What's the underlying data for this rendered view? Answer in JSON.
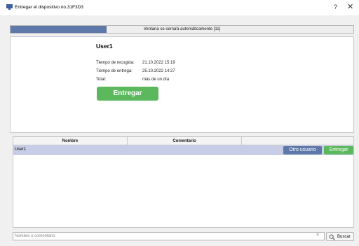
{
  "window": {
    "title": "Entregar el dispositivo no.31F3D3",
    "help": "?",
    "close": "✕"
  },
  "progress": {
    "text": "Ventana se cerrará automáticamente [11]",
    "fraction": 0.28,
    "color": "#5d78a9"
  },
  "info": {
    "user": "User1",
    "pickup_label": "Tiempo de recogida:",
    "pickup_value": "21.10.2022 15:19",
    "delivery_label": "Tiempo de entrega:",
    "delivery_value": "25.10.2022 14:27",
    "total_label": "Total:",
    "total_value": "más de un día",
    "deliver_button": "Entregar"
  },
  "table": {
    "columns": [
      "Nombre",
      "Comentario",
      ""
    ],
    "rows": [
      {
        "name": "User1",
        "comment": "",
        "other_user_button": "Otro usuario",
        "deliver_button": "Entregar"
      }
    ]
  },
  "search": {
    "placeholder": "Nombre o comentario",
    "clear": "×",
    "button": "Buscar"
  },
  "colors": {
    "accent": "#5d78a9",
    "success": "#5cb85c",
    "row_selected": "#c7cde6"
  }
}
